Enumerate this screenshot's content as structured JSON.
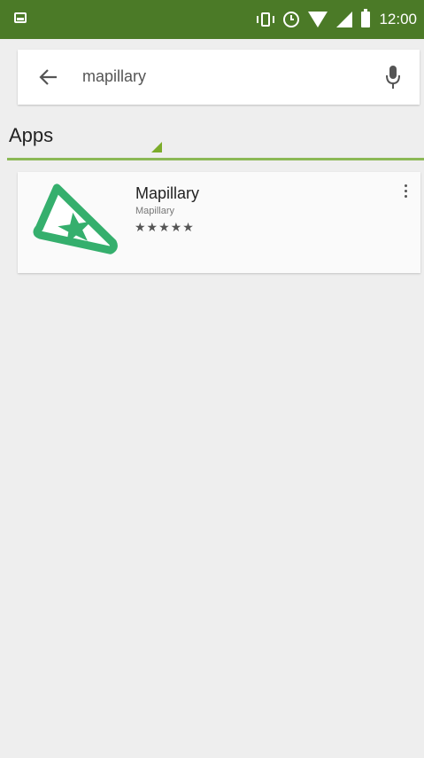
{
  "status_bar": {
    "time": "12:00",
    "icons": [
      "gallery-icon",
      "vibrate-icon",
      "alarm-icon",
      "wifi-icon",
      "signal-icon",
      "battery-icon"
    ],
    "background": "#4b7a27"
  },
  "search": {
    "query": "mapillary",
    "back_icon": "back-arrow-icon",
    "mic_icon": "microphone-icon"
  },
  "section": {
    "title": "Apps",
    "accent": "#7cac2a"
  },
  "app_result": {
    "name": "Mapillary",
    "developer": "Mapillary",
    "rating_stars": "★★★★★",
    "rating": 4.5,
    "logo_icon": "mapillary-logo-icon",
    "overflow_icon": "more-vert-icon",
    "brand_color": "#35af6d"
  }
}
